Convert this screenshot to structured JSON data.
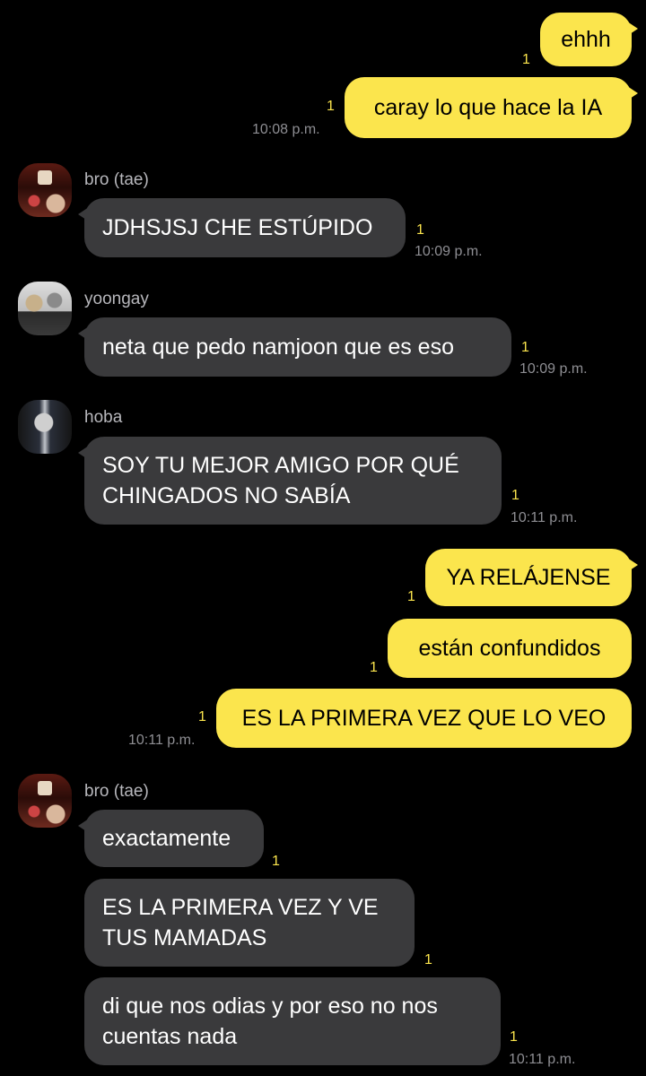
{
  "messages": [
    {
      "text": "ehhh",
      "unread": "1"
    },
    {
      "text": "caray lo que hace la IA",
      "unread": "1",
      "time": "10:08 p.m."
    },
    {
      "sender": "bro (tae)",
      "text": "JDHSJSJ CHE ESTÚPIDO",
      "unread": "1",
      "time": "10:09 p.m."
    },
    {
      "sender": "yoongay",
      "text": "neta que pedo namjoon que es eso",
      "unread": "1",
      "time": "10:09 p.m."
    },
    {
      "sender": "hoba",
      "text": "SOY TU MEJOR AMIGO POR QUÉ CHINGADOS NO SABÍA",
      "unread": "1",
      "time": "10:11 p.m."
    },
    {
      "text": "YA RELÁJENSE",
      "unread": "1"
    },
    {
      "text": "están confundidos",
      "unread": "1"
    },
    {
      "text": "ES LA PRIMERA VEZ QUE LO VEO",
      "unread": "1",
      "time": "10:11 p.m."
    },
    {
      "sender": "bro (tae)",
      "text": "exactamente",
      "unread": "1"
    },
    {
      "text": "ES LA PRIMERA VEZ Y VE TUS MAMADAS",
      "unread": "1"
    },
    {
      "text": "di que nos odias y por eso no nos cuentas nada",
      "unread": "1",
      "time": "10:11 p.m."
    }
  ],
  "colors": {
    "background": "#000000",
    "outgoing_bubble": "#fbe54d",
    "incoming_bubble": "#3a3a3c",
    "unread_count": "#fbe54d",
    "timestamp": "#8e8e93"
  }
}
